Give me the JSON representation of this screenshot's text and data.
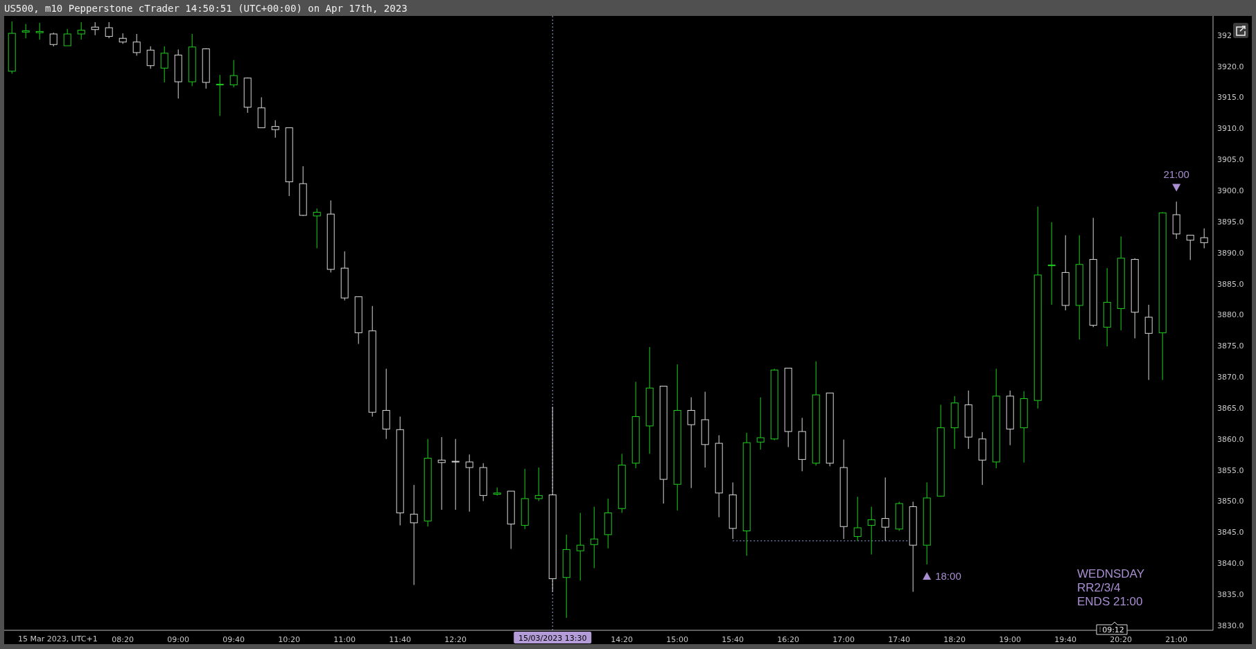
{
  "window": {
    "title": "US500, m10 Pepperstone cTrader 14:50:51 (UTC+00:00) on Apr 17th, 2023"
  },
  "chart": {
    "axis_start_label": "15 Mar 2023, UTC+1",
    "cut_price_label": "392",
    "crosshair_label": "15/03/2023 13:30",
    "countdown": "09:12",
    "note": [
      "WEDNSDAY",
      "RR2/3/4",
      "ENDS 21:00"
    ],
    "chart_data": {
      "type": "candlestick",
      "x": [
        420,
        430,
        440,
        450,
        460,
        470,
        480,
        490,
        500,
        510,
        520,
        530,
        540,
        550,
        560,
        570,
        580,
        590,
        600,
        610,
        620,
        630,
        640,
        650,
        660,
        670,
        680,
        690,
        700,
        710,
        720,
        730,
        740,
        750,
        760,
        770,
        780,
        790,
        800,
        810,
        820,
        830,
        840,
        850,
        860,
        870,
        880,
        890,
        900,
        910,
        920,
        930,
        940,
        950,
        960,
        970,
        980,
        990,
        1000,
        1010,
        1020,
        1030,
        1040,
        1050,
        1060,
        1070,
        1080,
        1090,
        1100,
        1110,
        1120,
        1130,
        1140,
        1150,
        1160,
        1170,
        1180,
        1190,
        1200,
        1210,
        1220,
        1230,
        1240,
        1250,
        1260,
        1270,
        1280
      ],
      "xlim": [
        414.4,
        1286.4
      ],
      "ohlc": [
        [
          3919.2,
          3927.2,
          3918.8,
          3925.3
        ],
        [
          3925.5,
          3926.8,
          3924.5,
          3925.7
        ],
        [
          3925.4,
          3927.0,
          3924.3,
          3925.6
        ],
        [
          3925.2,
          3925.4,
          3923.2,
          3923.5
        ],
        [
          3923.3,
          3926.0,
          3923.3,
          3925.2
        ],
        [
          3925.2,
          3927.1,
          3924.3,
          3925.8
        ],
        [
          3926.3,
          3927.1,
          3925.0,
          3925.9
        ],
        [
          3926.2,
          3927.1,
          3924.5,
          3924.8
        ],
        [
          3924.5,
          3925.3,
          3923.6,
          3923.9
        ],
        [
          3923.9,
          3925.2,
          3921.7,
          3922.2
        ],
        [
          3922.6,
          3923.2,
          3919.6,
          3920.1
        ],
        [
          3919.7,
          3923.2,
          3917.4,
          3922.1
        ],
        [
          3921.8,
          3922.7,
          3914.8,
          3917.5
        ],
        [
          3917.5,
          3925.2,
          3916.8,
          3923.1
        ],
        [
          3922.8,
          3922.9,
          3916.4,
          3917.4
        ],
        [
          3917.0,
          3918.6,
          3912.0,
          3917.1
        ],
        [
          3917.0,
          3921.0,
          3916.6,
          3918.5
        ],
        [
          3918.1,
          3918.2,
          3912.5,
          3913.4
        ],
        [
          3913.3,
          3915.0,
          3910.1,
          3910.1
        ],
        [
          3910.3,
          3911.3,
          3908.5,
          3909.8
        ],
        [
          3910.1,
          3910.1,
          3899.1,
          3901.4
        ],
        [
          3901.1,
          3903.9,
          3895.9,
          3896.0
        ],
        [
          3895.9,
          3897.1,
          3890.7,
          3896.5
        ],
        [
          3896.2,
          3898.4,
          3886.8,
          3887.3
        ],
        [
          3887.5,
          3890.2,
          3882.3,
          3882.7
        ],
        [
          3882.9,
          3882.9,
          3875.3,
          3877.1
        ],
        [
          3877.4,
          3881.4,
          3863.6,
          3864.3
        ],
        [
          3864.6,
          3871.3,
          3860.0,
          3861.6
        ],
        [
          3861.5,
          3863.6,
          3846.1,
          3848.1
        ],
        [
          3847.9,
          3852.6,
          3836.5,
          3846.5
        ],
        [
          3846.8,
          3860.0,
          3845.9,
          3856.9
        ],
        [
          3856.6,
          3860.3,
          3848.6,
          3856.2
        ],
        [
          3856.4,
          3860.0,
          3848.6,
          3856.3
        ],
        [
          3856.3,
          3857.5,
          3848.3,
          3855.4
        ],
        [
          3855.4,
          3856.1,
          3850.0,
          3850.9
        ],
        [
          3851.1,
          3852.2,
          3850.9,
          3851.3
        ],
        [
          3851.6,
          3851.6,
          3842.3,
          3846.3
        ],
        [
          3846.1,
          3855.2,
          3845.5,
          3850.4
        ],
        [
          3850.4,
          3855.4,
          3850.0,
          3850.9
        ],
        [
          3851.0,
          3865.2,
          3835.4,
          3837.5
        ],
        [
          3837.7,
          3844.6,
          3831.2,
          3842.2
        ],
        [
          3842.0,
          3848.1,
          3837.2,
          3842.9
        ],
        [
          3843.0,
          3849.1,
          3839.2,
          3843.9
        ],
        [
          3844.6,
          3850.4,
          3842.4,
          3848.1
        ],
        [
          3848.8,
          3857.6,
          3848.1,
          3855.8
        ],
        [
          3856.1,
          3869.2,
          3855.3,
          3863.6
        ],
        [
          3862.1,
          3874.8,
          3857.6,
          3868.2
        ],
        [
          3868.5,
          3868.5,
          3849.6,
          3853.5
        ],
        [
          3852.7,
          3872.0,
          3848.5,
          3864.6
        ],
        [
          3864.6,
          3866.7,
          3852.1,
          3862.3
        ],
        [
          3863.1,
          3867.6,
          3855.4,
          3859.1
        ],
        [
          3859.3,
          3860.6,
          3847.4,
          3851.3
        ],
        [
          3851.0,
          3853.0,
          3843.9,
          3845.6
        ],
        [
          3845.2,
          3861.0,
          3841.2,
          3859.4
        ],
        [
          3859.5,
          3866.7,
          3858.3,
          3860.2
        ],
        [
          3860.0,
          3871.3,
          3859.8,
          3871.1
        ],
        [
          3871.4,
          3871.4,
          3858.7,
          3861.2
        ],
        [
          3861.2,
          3863.4,
          3854.8,
          3856.7
        ],
        [
          3856.1,
          3872.5,
          3855.7,
          3867.1
        ],
        [
          3867.4,
          3867.4,
          3855.6,
          3856.1
        ],
        [
          3855.4,
          3859.9,
          3843.9,
          3845.9
        ],
        [
          3844.3,
          3850.7,
          3843.6,
          3845.7
        ],
        [
          3846.1,
          3849.1,
          3841.4,
          3847.0
        ],
        [
          3847.2,
          3853.8,
          3843.6,
          3845.8
        ],
        [
          3845.5,
          3849.9,
          3845.2,
          3849.6
        ],
        [
          3849.1,
          3849.9,
          3835.4,
          3842.9
        ],
        [
          3842.9,
          3853.0,
          3839.8,
          3850.5
        ],
        [
          3850.8,
          3865.5,
          3850.7,
          3861.8
        ],
        [
          3861.8,
          3866.9,
          3858.4,
          3865.8
        ],
        [
          3865.5,
          3867.8,
          3858.4,
          3860.3
        ],
        [
          3860.0,
          3861.1,
          3852.6,
          3856.6
        ],
        [
          3856.3,
          3871.3,
          3855.3,
          3866.9
        ],
        [
          3866.9,
          3867.8,
          3859.0,
          3861.6
        ],
        [
          3861.8,
          3867.7,
          3856.2,
          3866.5
        ],
        [
          3866.2,
          3897.4,
          3864.9,
          3886.4
        ],
        [
          3887.9,
          3894.9,
          3881.6,
          3888.0
        ],
        [
          3886.8,
          3892.8,
          3880.7,
          3881.5
        ],
        [
          3881.5,
          3892.8,
          3876.0,
          3888.1
        ],
        [
          3888.9,
          3895.6,
          3878.0,
          3878.3
        ],
        [
          3878.0,
          3887.5,
          3874.9,
          3882.0
        ],
        [
          3881.0,
          3892.6,
          3877.5,
          3889.1
        ],
        [
          3888.9,
          3889.1,
          3876.2,
          3880.4
        ],
        [
          3879.6,
          3881.6,
          3869.5,
          3877.0
        ],
        [
          3877.1,
          3896.5,
          3869.5,
          3896.4
        ],
        [
          3896.1,
          3898.2,
          3892.2,
          3893.0
        ],
        [
          3892.8,
          3892.8,
          3888.8,
          3892.0
        ],
        [
          3892.4,
          3893.9,
          3890.7,
          3891.6
        ]
      ],
      "ylim": [
        3829.2,
        3928.1
      ],
      "yticks": [
        {
          "value": 3920,
          "label": "3920.0"
        },
        {
          "value": 3915,
          "label": "3915.0"
        },
        {
          "value": 3910,
          "label": "3910.0"
        },
        {
          "value": 3905,
          "label": "3905.0"
        },
        {
          "value": 3900,
          "label": "3900.0"
        },
        {
          "value": 3895,
          "label": "3895.0"
        },
        {
          "value": 3890,
          "label": "3890.0"
        },
        {
          "value": 3885,
          "label": "3885.0"
        },
        {
          "value": 3880,
          "label": "3880.0"
        },
        {
          "value": 3875,
          "label": "3875.0"
        },
        {
          "value": 3870,
          "label": "3870.0"
        },
        {
          "value": 3865,
          "label": "3865.0"
        },
        {
          "value": 3860,
          "label": "3860.0"
        },
        {
          "value": 3855,
          "label": "3855.0"
        },
        {
          "value": 3850,
          "label": "3850.0"
        },
        {
          "value": 3845,
          "label": "3845.0"
        },
        {
          "value": 3840,
          "label": "3840.0"
        },
        {
          "value": 3835,
          "label": "3835.0"
        },
        {
          "value": 3830,
          "label": "3830.0"
        }
      ],
      "xticks": [
        {
          "value": 500,
          "label": "08:20"
        },
        {
          "value": 540,
          "label": "09:00"
        },
        {
          "value": 580,
          "label": "09:40"
        },
        {
          "value": 620,
          "label": "10:20"
        },
        {
          "value": 660,
          "label": "11:00"
        },
        {
          "value": 700,
          "label": "11:40"
        },
        {
          "value": 740,
          "label": "12:20"
        },
        {
          "value": 860,
          "label": "14:20"
        },
        {
          "value": 900,
          "label": "15:00"
        },
        {
          "value": 940,
          "label": "15:40"
        },
        {
          "value": 980,
          "label": "16:20"
        },
        {
          "value": 1020,
          "label": "17:00"
        },
        {
          "value": 1060,
          "label": "17:40"
        },
        {
          "value": 1100,
          "label": "18:20"
        },
        {
          "value": 1140,
          "label": "19:00"
        },
        {
          "value": 1180,
          "label": "19:40"
        },
        {
          "value": 1220,
          "label": "20:20"
        },
        {
          "value": 1260,
          "label": "21:00"
        }
      ],
      "ref_lines": [
        {
          "axis": "x",
          "value": 810
        },
        {
          "axis": "y",
          "value": 3843.6
        }
      ],
      "annotations": [
        {
          "x": 1080,
          "y": 3837.9,
          "text": "18:00"
        },
        {
          "x": 1260,
          "y": 3900.5,
          "text": "21:00"
        }
      ]
    }
  }
}
